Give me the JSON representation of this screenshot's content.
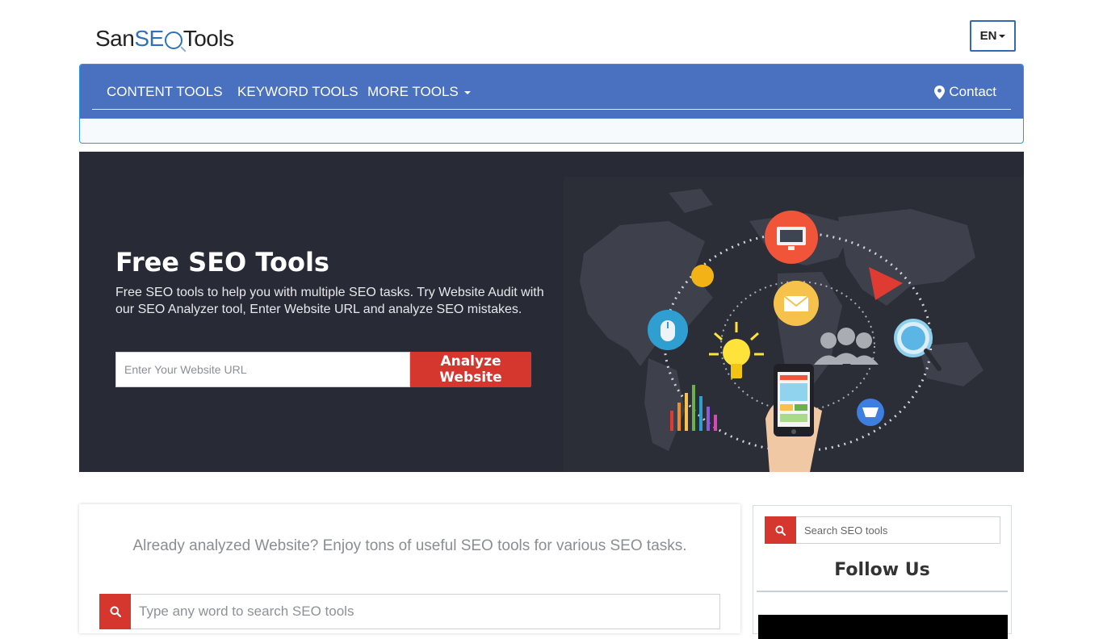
{
  "brand": {
    "part1": "San",
    "part2": "SE",
    "part3": "Tools"
  },
  "lang": {
    "label": "EN"
  },
  "nav": {
    "items": [
      "CONTENT TOOLS",
      "KEYWORD TOOLS",
      "MORE TOOLS"
    ],
    "contact": "Contact"
  },
  "hero": {
    "title": "Free SEO Tools",
    "description": "Free SEO tools to help you with multiple SEO tasks. Try Website Audit with our SEO Analyzer tool, Enter Website URL and analyze SEO mistakes.",
    "url_placeholder": "Enter Your Website URL",
    "button": "Analyze Website"
  },
  "main": {
    "tagline": "Already analyzed Website? Enjoy tons of useful SEO tools for various SEO tasks.",
    "search_placeholder": "Type any word to search SEO tools"
  },
  "sidebar": {
    "search_placeholder": "Search SEO tools",
    "follow_title": "Follow Us"
  },
  "colors": {
    "nav_bg": "#4a70c0",
    "accent_red": "#d5372f",
    "hero_bg": "#282b35",
    "brand_blue": "#2f72b9"
  },
  "icons": [
    "search-icon",
    "map-marker-icon",
    "caret-down-icon",
    "monitor-icon",
    "mail-icon",
    "mouse-icon",
    "lightbulb-icon",
    "users-icon",
    "magnifier-icon",
    "cart-icon",
    "smartphone-icon",
    "play-icon"
  ]
}
